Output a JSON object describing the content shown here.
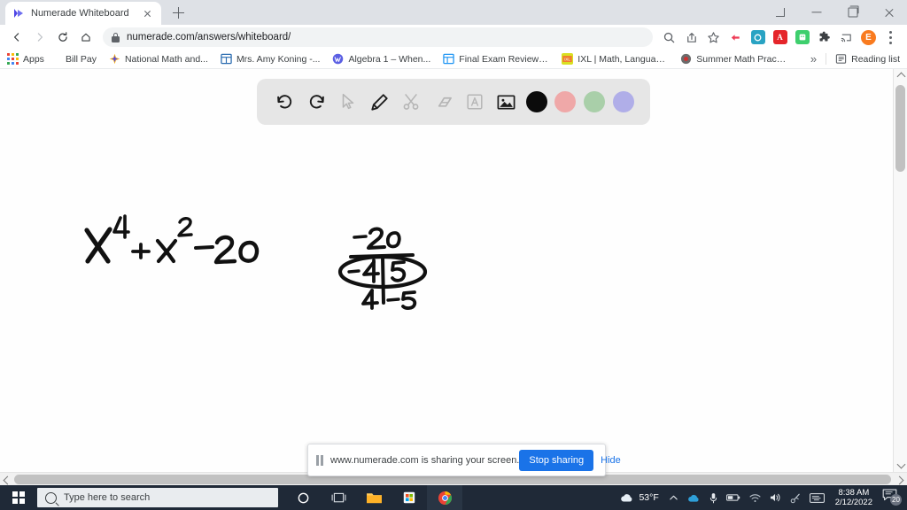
{
  "browser": {
    "tab": {
      "title": "Numerade Whiteboard",
      "favicon": "numerade-logo-icon",
      "close_icon": "close-icon"
    },
    "new_tab_label": "+",
    "window_controls": [
      {
        "name": "tab-search-button",
        "icon": "chevron-down-icon"
      },
      {
        "name": "minimize-button",
        "icon": "minimize-icon"
      },
      {
        "name": "maximize-button",
        "icon": "maximize-icon"
      },
      {
        "name": "close-window-button",
        "icon": "close-icon"
      }
    ],
    "nav": {
      "back_icon": "back-arrow-icon",
      "forward_icon": "forward-arrow-icon",
      "reload_icon": "reload-icon",
      "home_icon": "home-icon",
      "lock_icon": "lock-icon",
      "url": "numerade.com/answers/whiteboard/"
    },
    "toolbar_icons": [
      {
        "name": "zoom-search-icon",
        "glyph": "search-icon"
      },
      {
        "name": "share-icon",
        "glyph": "share-icon"
      },
      {
        "name": "bookmark-star-icon",
        "glyph": "star-icon"
      },
      {
        "name": "extension-red-icon",
        "glyph": "puzzle-extension-icon",
        "color": "#ee3a55"
      },
      {
        "name": "extension-teal-icon",
        "glyph": "extension-icon",
        "color": "#29a3c3"
      },
      {
        "name": "adobe-acrobat-icon",
        "glyph": "pdf-icon",
        "color": "#e5252a"
      },
      {
        "name": "extension-green-icon",
        "glyph": "extension-icon",
        "color": "#34c759"
      },
      {
        "name": "extensions-puzzle-icon",
        "glyph": "puzzle-icon"
      },
      {
        "name": "cast-icon",
        "glyph": "cast-icon"
      },
      {
        "name": "profile-avatar",
        "glyph": "avatar",
        "initial": "E",
        "color": "#f97b1f"
      },
      {
        "name": "chrome-menu-button",
        "glyph": "kebab-menu-icon"
      }
    ],
    "bookmarks": [
      {
        "label": "Apps",
        "icon": "apps-grid-icon"
      },
      {
        "label": "Bill Pay",
        "icon": "none"
      },
      {
        "label": "National Math and...",
        "icon": "star-burst-icon",
        "color": "#f5b01a"
      },
      {
        "label": "Mrs. Amy Koning -...",
        "icon": "calendar-icon",
        "color": "#2b6cb0"
      },
      {
        "label": "Algebra 1 – When...",
        "icon": "wordpress-icon",
        "color": "#464de4"
      },
      {
        "label": "Final Exam Review -...",
        "icon": "table-icon",
        "color": "#2196f3"
      },
      {
        "label": "IXL | Math, Languag...",
        "icon": "ixl-icon",
        "color": "#d9e021"
      },
      {
        "label": "Summer Math Pract...",
        "icon": "globe-icon",
        "color": "#5a5a5a"
      }
    ],
    "bookmarks_overflow": "»",
    "reading_list": {
      "label": "Reading list",
      "icon": "reading-list-icon"
    }
  },
  "whiteboard": {
    "toolbar": [
      {
        "name": "undo-button",
        "icon": "undo-icon",
        "state": "enabled"
      },
      {
        "name": "redo-button",
        "icon": "redo-icon",
        "state": "enabled"
      },
      {
        "name": "select-tool",
        "icon": "cursor-arrow-icon",
        "state": "disabled"
      },
      {
        "name": "pencil-tool",
        "icon": "pencil-icon",
        "state": "active"
      },
      {
        "name": "scissors-tool",
        "icon": "scissors-icon",
        "state": "disabled"
      },
      {
        "name": "eraser-tool",
        "icon": "eraser-icon",
        "state": "disabled"
      },
      {
        "name": "text-tool",
        "icon": "text-a-icon",
        "state": "disabled"
      },
      {
        "name": "image-tool",
        "icon": "image-icon",
        "state": "enabled"
      }
    ],
    "colors": [
      {
        "name": "color-black",
        "hex": "#0b0b0b",
        "selected": true
      },
      {
        "name": "color-pink",
        "hex": "#efa8a8",
        "selected": false
      },
      {
        "name": "color-green",
        "hex": "#a9cfa9",
        "selected": false
      },
      {
        "name": "color-purple",
        "hex": "#b0aee8",
        "selected": false
      }
    ],
    "ink": {
      "equation": "X⁴ + x² − 20",
      "x_diagram": {
        "top": "-20",
        "left": "-4",
        "right": "5",
        "bottom_left": "4",
        "bottom_right": "-5"
      }
    }
  },
  "share_bar": {
    "pause_icon": "pause-icon",
    "message": "www.numerade.com is sharing your screen.",
    "stop_label": "Stop sharing",
    "hide_label": "Hide"
  },
  "taskbar": {
    "start_icon": "windows-start-icon",
    "search_placeholder": "Type here to search",
    "search_icon": "search-icon",
    "apps": [
      {
        "name": "cortana-button",
        "icon": "cortana-circle-icon"
      },
      {
        "name": "task-view-button",
        "icon": "task-view-icon"
      },
      {
        "name": "file-explorer-button",
        "icon": "folder-icon"
      },
      {
        "name": "microsoft-store-button",
        "icon": "store-icon"
      },
      {
        "name": "chrome-button",
        "icon": "chrome-icon"
      }
    ],
    "weather": {
      "icon": "cloud-icon",
      "temperature": "53°F"
    },
    "tray": [
      {
        "name": "show-hidden-icons",
        "icon": "chevron-up-icon"
      },
      {
        "name": "onedrive-icon",
        "icon": "cloud-icon",
        "color": "#2e9fd8"
      },
      {
        "name": "microphone-icon",
        "icon": "microphone-icon"
      },
      {
        "name": "battery-icon",
        "icon": "battery-icon"
      },
      {
        "name": "wifi-icon",
        "icon": "wifi-icon"
      },
      {
        "name": "volume-icon",
        "icon": "speaker-icon"
      },
      {
        "name": "pen-menu-icon",
        "icon": "pen-icon"
      },
      {
        "name": "touch-keyboard-icon",
        "icon": "keyboard-icon"
      }
    ],
    "clock": {
      "time": "8:38 AM",
      "date": "2/12/2022"
    },
    "notifications": {
      "icon": "notification-icon",
      "count": "20"
    }
  }
}
